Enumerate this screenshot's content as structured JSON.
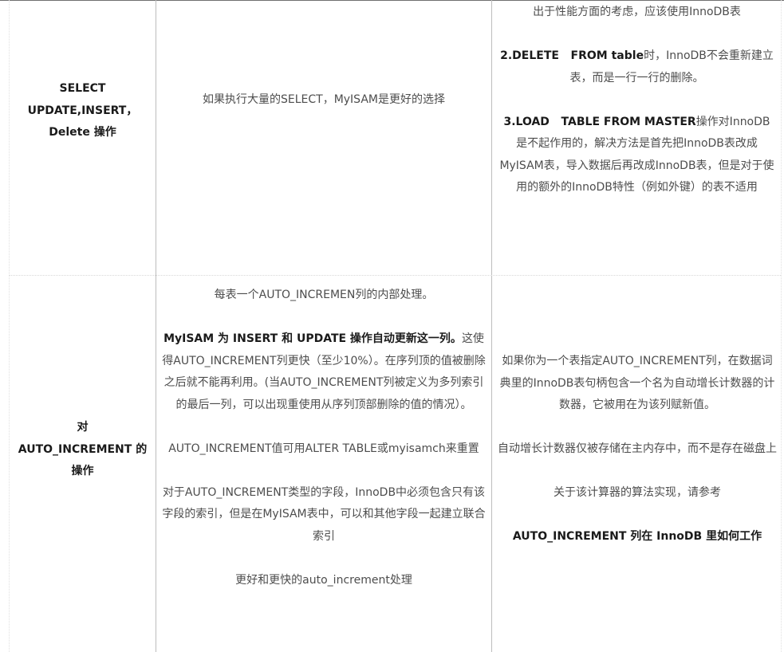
{
  "rows": [
    {
      "label_lines": [
        "SELECT",
        "UPDATE,INSERT，",
        "Delete 操作"
      ],
      "myisam": "如果执行大量的SELECT，MyISAM是更好的选择",
      "innodb": {
        "p1": "出于性能方面的考虑，应该使用InnoDB表",
        "p2_bold": "2.DELETE   FROM table",
        "p2_rest": "时，InnoDB不会重新建立表，而是一行一行的删除。",
        "p3_bold": "3.LOAD   TABLE FROM MASTER",
        "p3_rest": "操作对InnoDB是不起作用的，解决方法是首先把InnoDB表改成MyISAM表，导入数据后再改成InnoDB表，但是对于使用的额外的InnoDB特性（例如外键）的表不适用"
      }
    },
    {
      "label_lines": [
        "对",
        "AUTO_INCREMENT 的",
        "操作"
      ],
      "myisam": {
        "p1": "每表一个AUTO_INCREMEN列的内部处理。",
        "p2_bold": "MyISAM 为 INSERT 和 UPDATE 操作自动更新这一列。",
        "p2_rest": "这使得AUTO_INCREMENT列更快（至少10%）。在序列顶的值被删除之后就不能再利用。(当AUTO_INCREMENT列被定义为多列索引的最后一列，可以出现重使用从序列顶部删除的值的情况）。",
        "p3": "AUTO_INCREMENT值可用ALTER TABLE或myisamch来重置",
        "p4": "对于AUTO_INCREMENT类型的字段，InnoDB中必须包含只有该字段的索引，但是在MyISAM表中，可以和其他字段一起建立联合索引",
        "p5": "更好和更快的auto_increment处理"
      },
      "innodb": {
        "p1": "如果你为一个表指定AUTO_INCREMENT列，在数据词典里的InnoDB表句柄包含一个名为自动增长计数器的计数器，它被用在为该列赋新值。",
        "p2": "自动增长计数器仅被存储在主内存中，而不是存在磁盘上",
        "p3": "关于该计算器的算法实现，请参考",
        "p4_bold": "AUTO_INCREMENT 列在 InnoDB 里如何工作"
      }
    }
  ]
}
